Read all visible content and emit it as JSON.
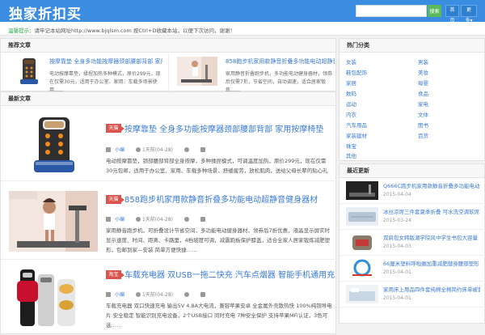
{
  "header": {
    "logo": "独家折扣买",
    "search_placeholder": "",
    "search_button": "搜索",
    "btn_home": "首页",
    "btn_more": "更多▾"
  },
  "notice": {
    "label": "温馨提示：",
    "text": "请牢记本站网址http://www.bjqlsm.com 按Ctrl+D收藏本站，以便下次访问，谢谢！"
  },
  "featured": {
    "title": "推荐文章",
    "items": [
      {
        "title": "按摩靠垫 全身多功能按摩器颈部腰部背部 家用按摩椅垫",
        "desc": "电动按摩靠垫，揉捏加热多种模式，原价299元，现在仅需30元，适用于办公室、家用、车载多场景使用……"
      },
      {
        "title": "858跑步机家用款静音折叠多功能电动超静音健身器材",
        "desc": "家用静音折叠跑步机，多功能电动健身器材，领券后仅需7折，节省空间，自动调速，适合居家锻炼……"
      }
    ]
  },
  "latest": {
    "title": "最新文章",
    "articles": [
      {
        "badge": "天猫",
        "title": "按摩靠垫 全身多功能按摩器颈部腰部背部 家用按摩椅垫",
        "author": "小编",
        "time": "1天前(04-28)",
        "desc": "电动按摩靠垫，颈部腰部背部全身按摩，多种揉捏模式，可调温度加热，原价299元，现在仅需30元包邮，适用于办公室、家用、车载多种场景，舒缓疲劳，放松肌肉，送给父母长辈的贴心礼物，智能定时 + 安全保护 舒适按摩享受，每日限量抢购中 数量有限先到先得……"
      },
      {
        "badge": "天猫",
        "title": "858跑步机家用款静音折叠多功能电动超静音健身器材",
        "author": "小编",
        "time": "1天前(04-28)",
        "desc": "家用静音跑步机，可折叠设计节省空间，多功能电动健身器材，领券后7折优惠，液晶显示屏实时显示速度、时间、距离、卡路里，4档坡度可调，减震跑板保护膝盖，适合全家人居家锻炼减肥塑形，包邮到家—安装 简单方便快捷……"
      },
      {
        "badge": "淘宝",
        "title": "车载充电器 双USB一拖二快充 汽车点烟器 智能手机通用充电",
        "author": "小编",
        "time": "1天前(04-28)",
        "desc": "车载充电器 双口快速充电 输出5V 4.8A大电流，兼容苹果安卓 全金属外壳散热快 100%纯铜导电片 安全稳定 智能识别充电设备，2个USB接口 同时充电 7种安全保护 支持苹果MFi认证，3色可选……"
      }
    ]
  },
  "categories": {
    "title": "热门分类",
    "items": [
      "女装",
      "男装",
      "鞋包配饰",
      "美妆",
      "家居",
      "母婴",
      "数码",
      "食品",
      "运动",
      "家电",
      "内衣",
      "文体",
      "汽车用品",
      "图书",
      "家装建材",
      "百货",
      "珠宝",
      "其他"
    ]
  },
  "recent": {
    "title": "最近更新",
    "items": [
      {
        "title": "Q666C跑步机家用款静音折叠多功能电动健身",
        "date": "2015-04-04"
      },
      {
        "title": "冰丝凉席三件套夏季折叠 可水洗空调软席",
        "date": "2015-03-24"
      },
      {
        "title": "双肩包女韩版潮学院风中学生书包大容量",
        "date": "2015-04-03"
      },
      {
        "title": "66厘米塑料呼啦圈加重减肥健身腰部塑形",
        "date": "2015-04-01"
      },
      {
        "title": "家用床上用品四件套纯棉全棉简约床单被套",
        "date": "2015-04-01"
      }
    ]
  }
}
